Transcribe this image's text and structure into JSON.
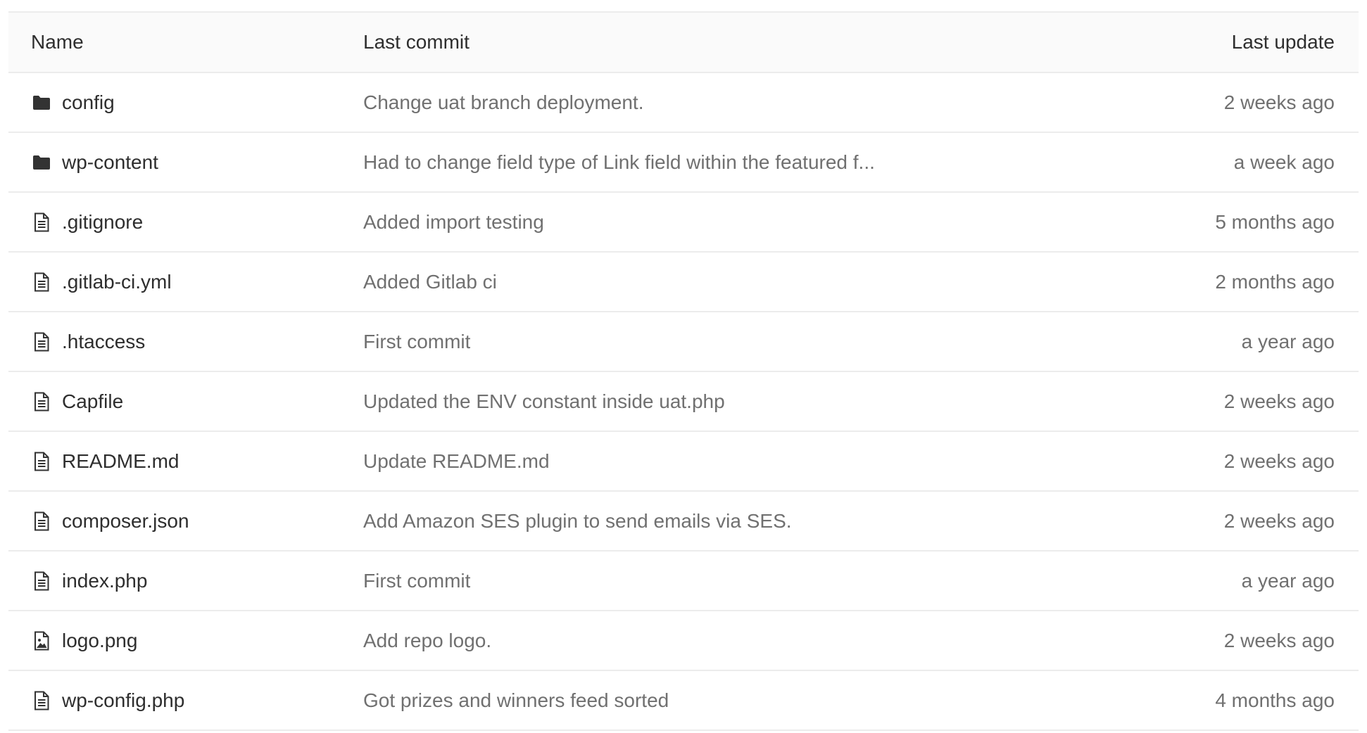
{
  "header": {
    "name": "Name",
    "last_commit": "Last commit",
    "last_update": "Last update"
  },
  "rows": [
    {
      "type": "folder",
      "icon": "folder-icon",
      "name": "config",
      "commit": "Change uat branch deployment.",
      "updated": "2 weeks ago"
    },
    {
      "type": "folder",
      "icon": "folder-icon",
      "name": "wp-content",
      "commit": "Had to change field type of Link field within the featured f...",
      "updated": "a week ago"
    },
    {
      "type": "file",
      "icon": "file-text-icon",
      "name": ".gitignore",
      "commit": "Added import testing",
      "updated": "5 months ago"
    },
    {
      "type": "file",
      "icon": "file-text-icon",
      "name": ".gitlab-ci.yml",
      "commit": "Added Gitlab ci",
      "updated": "2 months ago"
    },
    {
      "type": "file",
      "icon": "file-text-icon",
      "name": ".htaccess",
      "commit": "First commit",
      "updated": "a year ago"
    },
    {
      "type": "file",
      "icon": "file-text-icon",
      "name": "Capfile",
      "commit": "Updated the ENV constant inside uat.php",
      "updated": "2 weeks ago"
    },
    {
      "type": "file",
      "icon": "file-text-icon",
      "name": "README.md",
      "commit": "Update README.md",
      "updated": "2 weeks ago"
    },
    {
      "type": "file",
      "icon": "file-text-icon",
      "name": "composer.json",
      "commit": "Add Amazon SES plugin to send emails via SES.",
      "updated": "2 weeks ago"
    },
    {
      "type": "file",
      "icon": "file-text-icon",
      "name": "index.php",
      "commit": "First commit",
      "updated": "a year ago"
    },
    {
      "type": "image",
      "icon": "file-image-icon",
      "name": "logo.png",
      "commit": "Add repo logo.",
      "updated": "2 weeks ago"
    },
    {
      "type": "file",
      "icon": "file-text-icon",
      "name": "wp-config.php",
      "commit": "Got prizes and winners feed sorted",
      "updated": "4 months ago"
    }
  ],
  "colors": {
    "text": "#2e2e2e",
    "muted": "#707070",
    "border": "#ececec",
    "header_bg": "#fafafa"
  }
}
